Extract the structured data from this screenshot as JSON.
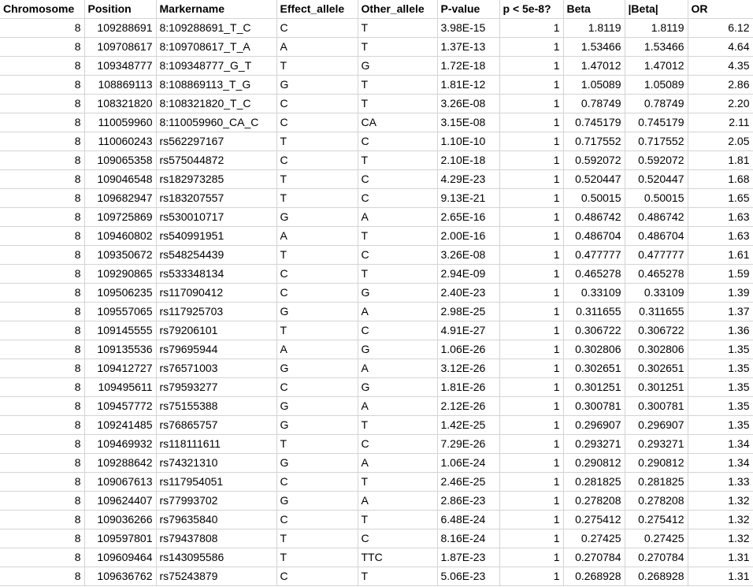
{
  "headers": [
    "Chromosome",
    "Position",
    "Markername",
    "Effect_allele",
    "Other_allele",
    "P-value",
    "p < 5e-8?",
    "Beta",
    "|Beta|",
    "OR"
  ],
  "rows": [
    [
      "8",
      "109288691",
      "8:109288691_T_C",
      "C",
      "T",
      "3.98E-15",
      "1",
      "1.8119",
      "1.8119",
      "6.12"
    ],
    [
      "8",
      "109708617",
      "8:109708617_T_A",
      "A",
      "T",
      "1.37E-13",
      "1",
      "1.53466",
      "1.53466",
      "4.64"
    ],
    [
      "8",
      "109348777",
      "8:109348777_G_T",
      "T",
      "G",
      "1.72E-18",
      "1",
      "1.47012",
      "1.47012",
      "4.35"
    ],
    [
      "8",
      "108869113",
      "8:108869113_T_G",
      "G",
      "T",
      "1.81E-12",
      "1",
      "1.05089",
      "1.05089",
      "2.86"
    ],
    [
      "8",
      "108321820",
      "8:108321820_T_C",
      "C",
      "T",
      "3.26E-08",
      "1",
      "0.78749",
      "0.78749",
      "2.20"
    ],
    [
      "8",
      "110059960",
      "8:110059960_CA_C",
      "C",
      "CA",
      "3.15E-08",
      "1",
      "0.745179",
      "0.745179",
      "2.11"
    ],
    [
      "8",
      "110060243",
      "rs562297167",
      "T",
      "C",
      "1.10E-10",
      "1",
      "0.717552",
      "0.717552",
      "2.05"
    ],
    [
      "8",
      "109065358",
      "rs575044872",
      "C",
      "T",
      "2.10E-18",
      "1",
      "0.592072",
      "0.592072",
      "1.81"
    ],
    [
      "8",
      "109046548",
      "rs182973285",
      "T",
      "C",
      "4.29E-23",
      "1",
      "0.520447",
      "0.520447",
      "1.68"
    ],
    [
      "8",
      "109682947",
      "rs183207557",
      "T",
      "C",
      "9.13E-21",
      "1",
      "0.50015",
      "0.50015",
      "1.65"
    ],
    [
      "8",
      "109725869",
      "rs530010717",
      "G",
      "A",
      "2.65E-16",
      "1",
      "0.486742",
      "0.486742",
      "1.63"
    ],
    [
      "8",
      "109460802",
      "rs540991951",
      "A",
      "T",
      "2.00E-16",
      "1",
      "0.486704",
      "0.486704",
      "1.63"
    ],
    [
      "8",
      "109350672",
      "rs548254439",
      "T",
      "C",
      "3.26E-08",
      "1",
      "0.477777",
      "0.477777",
      "1.61"
    ],
    [
      "8",
      "109290865",
      "rs533348134",
      "C",
      "T",
      "2.94E-09",
      "1",
      "0.465278",
      "0.465278",
      "1.59"
    ],
    [
      "8",
      "109506235",
      "rs117090412",
      "C",
      "G",
      "2.40E-23",
      "1",
      "0.33109",
      "0.33109",
      "1.39"
    ],
    [
      "8",
      "109557065",
      "rs117925703",
      "G",
      "A",
      "2.98E-25",
      "1",
      "0.311655",
      "0.311655",
      "1.37"
    ],
    [
      "8",
      "109145555",
      "rs79206101",
      "T",
      "C",
      "4.91E-27",
      "1",
      "0.306722",
      "0.306722",
      "1.36"
    ],
    [
      "8",
      "109135536",
      "rs79695944",
      "A",
      "G",
      "1.06E-26",
      "1",
      "0.302806",
      "0.302806",
      "1.35"
    ],
    [
      "8",
      "109412727",
      "rs76571003",
      "G",
      "A",
      "3.12E-26",
      "1",
      "0.302651",
      "0.302651",
      "1.35"
    ],
    [
      "8",
      "109495611",
      "rs79593277",
      "C",
      "G",
      "1.81E-26",
      "1",
      "0.301251",
      "0.301251",
      "1.35"
    ],
    [
      "8",
      "109457772",
      "rs75155388",
      "G",
      "A",
      "2.12E-26",
      "1",
      "0.300781",
      "0.300781",
      "1.35"
    ],
    [
      "8",
      "109241485",
      "rs76865757",
      "G",
      "T",
      "1.42E-25",
      "1",
      "0.296907",
      "0.296907",
      "1.35"
    ],
    [
      "8",
      "109469932",
      "rs118111611",
      "T",
      "C",
      "7.29E-26",
      "1",
      "0.293271",
      "0.293271",
      "1.34"
    ],
    [
      "8",
      "109288642",
      "rs74321310",
      "G",
      "A",
      "1.06E-24",
      "1",
      "0.290812",
      "0.290812",
      "1.34"
    ],
    [
      "8",
      "109067613",
      "rs117954051",
      "C",
      "T",
      "2.46E-25",
      "1",
      "0.281825",
      "0.281825",
      "1.33"
    ],
    [
      "8",
      "109624407",
      "rs77993702",
      "G",
      "A",
      "2.86E-23",
      "1",
      "0.278208",
      "0.278208",
      "1.32"
    ],
    [
      "8",
      "109036266",
      "rs79635840",
      "C",
      "T",
      "6.48E-24",
      "1",
      "0.275412",
      "0.275412",
      "1.32"
    ],
    [
      "8",
      "109597801",
      "rs79437808",
      "T",
      "C",
      "8.16E-24",
      "1",
      "0.27425",
      "0.27425",
      "1.32"
    ],
    [
      "8",
      "109609464",
      "rs143095586",
      "T",
      "TTC",
      "1.87E-23",
      "1",
      "0.270784",
      "0.270784",
      "1.31"
    ],
    [
      "8",
      "109636762",
      "rs75243879",
      "C",
      "T",
      "5.06E-23",
      "1",
      "0.268928",
      "0.268928",
      "1.31"
    ]
  ]
}
